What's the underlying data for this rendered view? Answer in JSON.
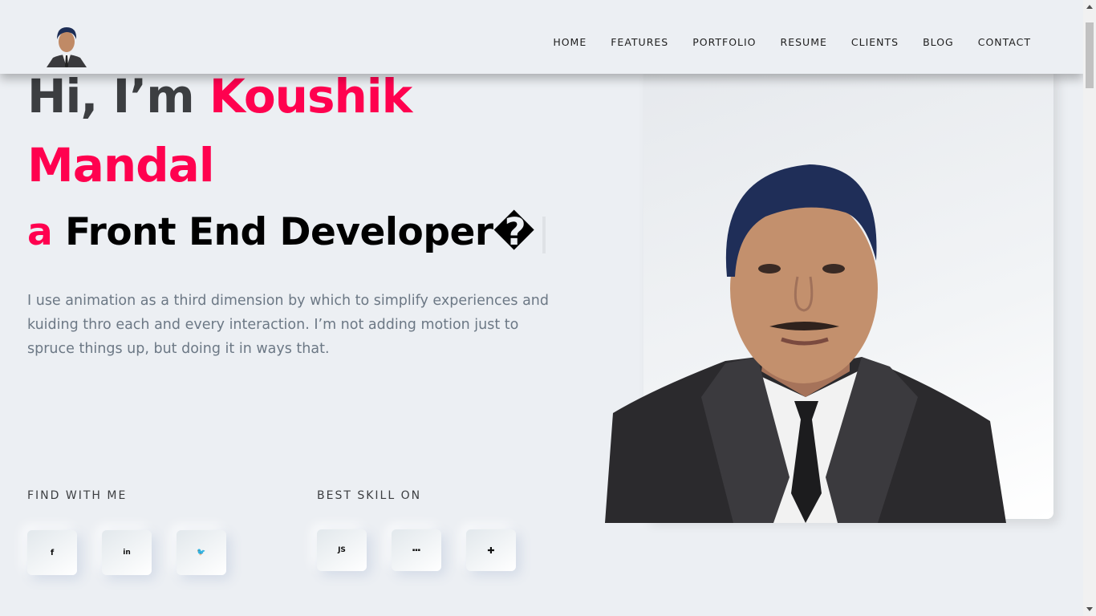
{
  "nav": [
    "HOME",
    "FEATURES",
    "PORTFOLIO",
    "RESUME",
    "CLIENTS",
    "BLOG",
    "CONTACT"
  ],
  "hero": {
    "greeting": "Hi, I’m ",
    "first_name": "Koushik",
    "last_name": "Mandal",
    "role_prefix": "a",
    "role": " Front End Developer",
    "role_glyph": "�",
    "description": "I use animation as a third dimension by which to simplify experiences and kuiding thro each and every interaction. I’m not adding motion just to spruce things up, but doing it in ways that."
  },
  "find": {
    "title": "FIND WITH ME",
    "icons": [
      "f",
      "in",
      "🐦"
    ],
    "icon_names": [
      "facebook-icon",
      "linkedin-icon",
      "twitter-icon"
    ]
  },
  "skills": {
    "title": "BEST SKILL ON",
    "icons": [
      "JS",
      "▪▪▪",
      "✚"
    ],
    "icon_names": [
      "javascript-icon",
      "react-icon",
      "figma-icon"
    ]
  },
  "colors": {
    "accent": "#ff014f",
    "background": "#eceff3",
    "text": "#3c3e41"
  }
}
